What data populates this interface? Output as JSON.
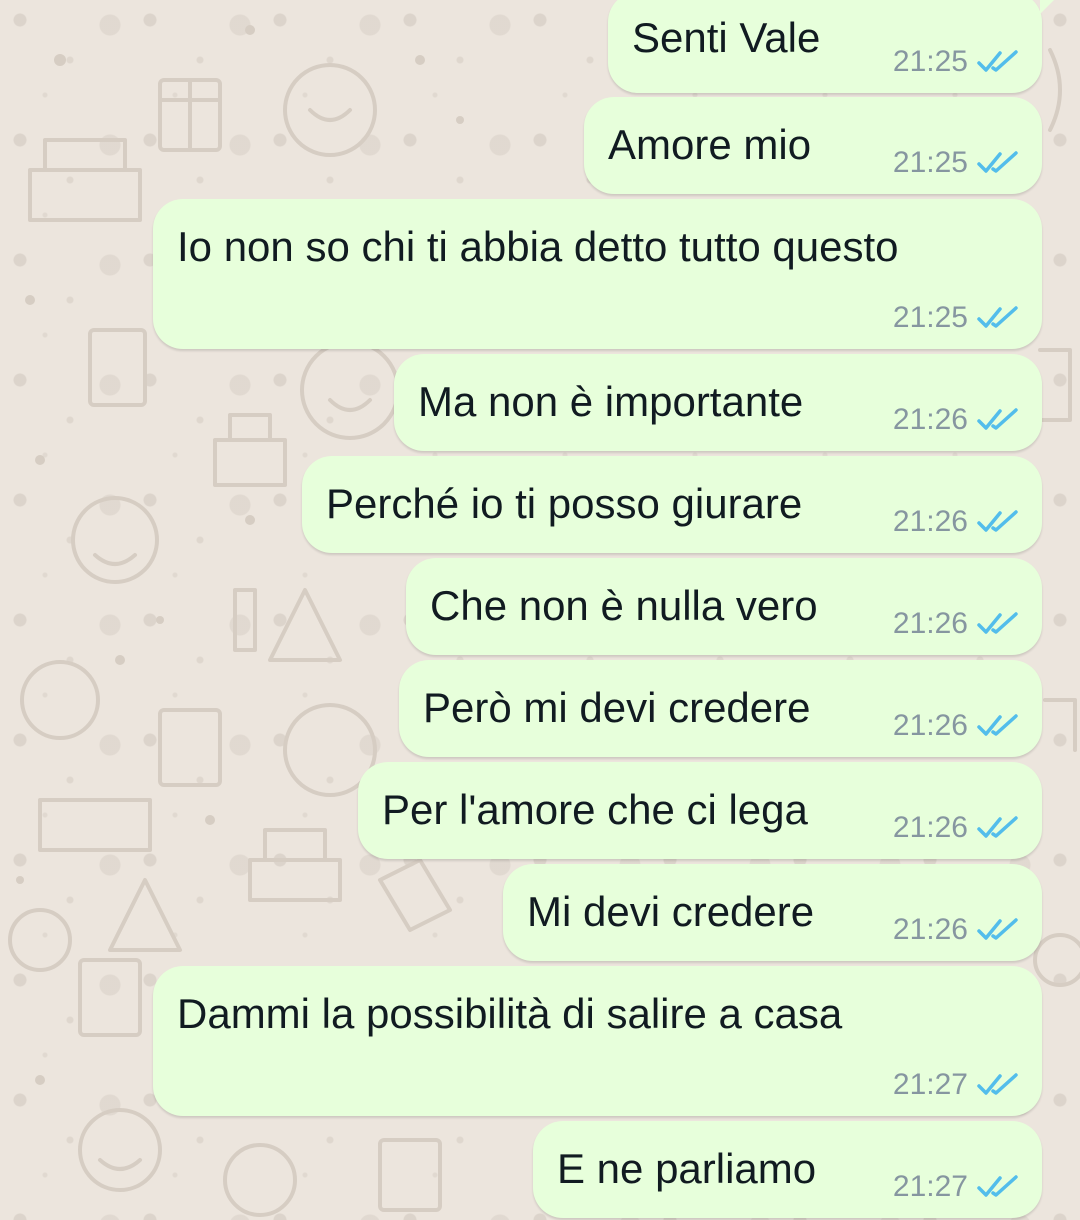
{
  "chat": {
    "messages": [
      {
        "text": "Senti Vale",
        "time": "21:25",
        "status": "read"
      },
      {
        "text": "Amore mio",
        "time": "21:25",
        "status": "read"
      },
      {
        "text": "Io non so chi ti abbia detto tutto questo",
        "time": "21:25",
        "status": "read"
      },
      {
        "text": "Ma non è importante",
        "time": "21:26",
        "status": "read"
      },
      {
        "text": "Perché io ti posso giurare",
        "time": "21:26",
        "status": "read"
      },
      {
        "text": "Che non è nulla vero",
        "time": "21:26",
        "status": "read"
      },
      {
        "text": "Però mi devi credere",
        "time": "21:26",
        "status": "read"
      },
      {
        "text": "Per l'amore che ci lega",
        "time": "21:26",
        "status": "read"
      },
      {
        "text": "Mi devi credere",
        "time": "21:26",
        "status": "read"
      },
      {
        "text": "Dammi la possibilità di salire a casa",
        "time": "21:27",
        "status": "read"
      },
      {
        "text": "E ne parliamo",
        "time": "21:27",
        "status": "read"
      }
    ]
  },
  "colors": {
    "background": "#ece5dd",
    "outgoing_bubble": "#e7ffdb",
    "read_ticks": "#53bdeb",
    "time_text": "#8696a0"
  },
  "icons": {
    "read_receipt": "double-check-icon"
  }
}
